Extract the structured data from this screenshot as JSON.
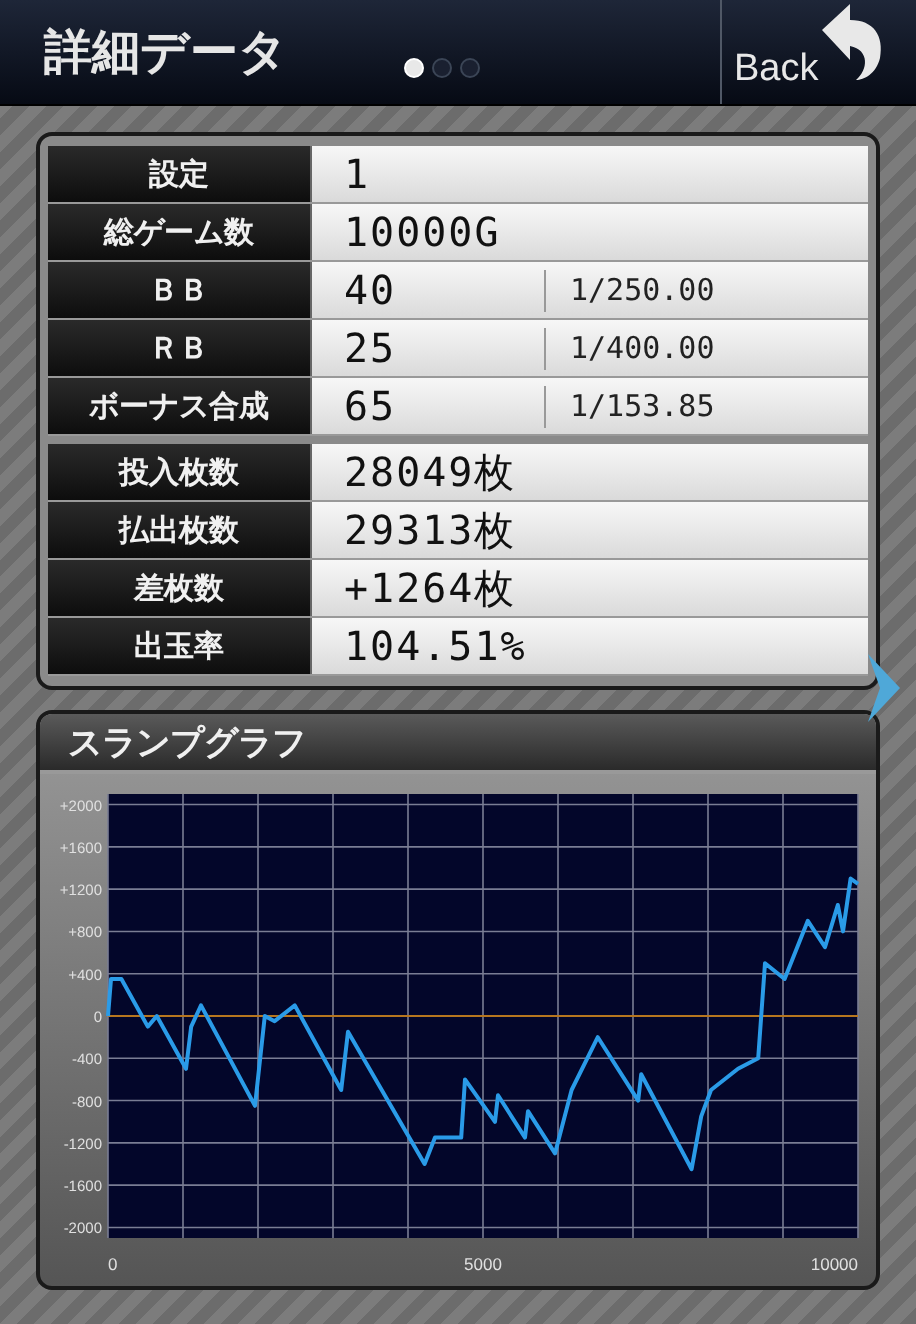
{
  "header": {
    "title": "詳細データ",
    "pages": [
      {
        "selected": true
      },
      {
        "selected": false
      },
      {
        "selected": false
      }
    ],
    "back": "Back"
  },
  "stats": [
    [
      {
        "label": "設定",
        "value": "1"
      },
      {
        "label": "総ゲーム数",
        "value": "10000G"
      },
      {
        "label": "ＢＢ",
        "value": "40",
        "ratio": "1/250.00"
      },
      {
        "label": "ＲＢ",
        "value": "25",
        "ratio": "1/400.00"
      },
      {
        "label": "ボーナス合成",
        "value": "65",
        "ratio": "1/153.85"
      }
    ],
    [
      {
        "label": "投入枚数",
        "value": "28049枚"
      },
      {
        "label": "払出枚数",
        "value": "29313枚"
      },
      {
        "label": "差枚数",
        "value": "+1264枚"
      },
      {
        "label": "出玉率",
        "value": "104.51%"
      }
    ]
  ],
  "graph": {
    "title": "スランプグラフ",
    "chart_data": {
      "type": "line",
      "x": [
        0,
        40,
        180,
        530,
        650,
        1040,
        1110,
        1240,
        1960,
        2090,
        2220,
        2490,
        3110,
        3200,
        4220,
        4360,
        4710,
        4760,
        5160,
        5200,
        5560,
        5600,
        5960,
        6180,
        6530,
        7070,
        7110,
        7780,
        7910,
        8040,
        8400,
        8670,
        8760,
        9020,
        9330,
        9560,
        9730,
        9800,
        9900,
        10000
      ],
      "series": [
        {
          "color": "#2a9be8",
          "values": [
            0,
            350,
            350,
            -100,
            0,
            -500,
            -100,
            100,
            -850,
            0,
            -50,
            100,
            -700,
            -150,
            -1400,
            -1150,
            -1150,
            -600,
            -1000,
            -750,
            -1150,
            -900,
            -1300,
            -700,
            -200,
            -800,
            -550,
            -1450,
            -950,
            -700,
            -500,
            -400,
            500,
            350,
            900,
            650,
            1050,
            800,
            1300,
            1250
          ]
        }
      ],
      "grid": true,
      "ref_lines": [
        {
          "axis": "y",
          "value": 0,
          "color": "#b7761e"
        }
      ],
      "xlim": [
        0,
        10000
      ],
      "ylim": [
        -2100,
        2100
      ],
      "xticks": [
        0,
        5000,
        10000
      ],
      "yticks": [
        {
          "value": 2000,
          "label": "+2000"
        },
        {
          "value": 1600,
          "label": "+1600"
        },
        {
          "value": 1200,
          "label": "+1200"
        },
        {
          "value": 800,
          "label": "+800"
        },
        {
          "value": 400,
          "label": "+400"
        },
        {
          "value": 0,
          "label": "0"
        },
        {
          "value": -400,
          "label": "-400"
        },
        {
          "value": -800,
          "label": "-800"
        },
        {
          "value": -1200,
          "label": "-1200"
        },
        {
          "value": -1600,
          "label": "-1600"
        },
        {
          "value": -2000,
          "label": "-2000"
        }
      ]
    }
  }
}
